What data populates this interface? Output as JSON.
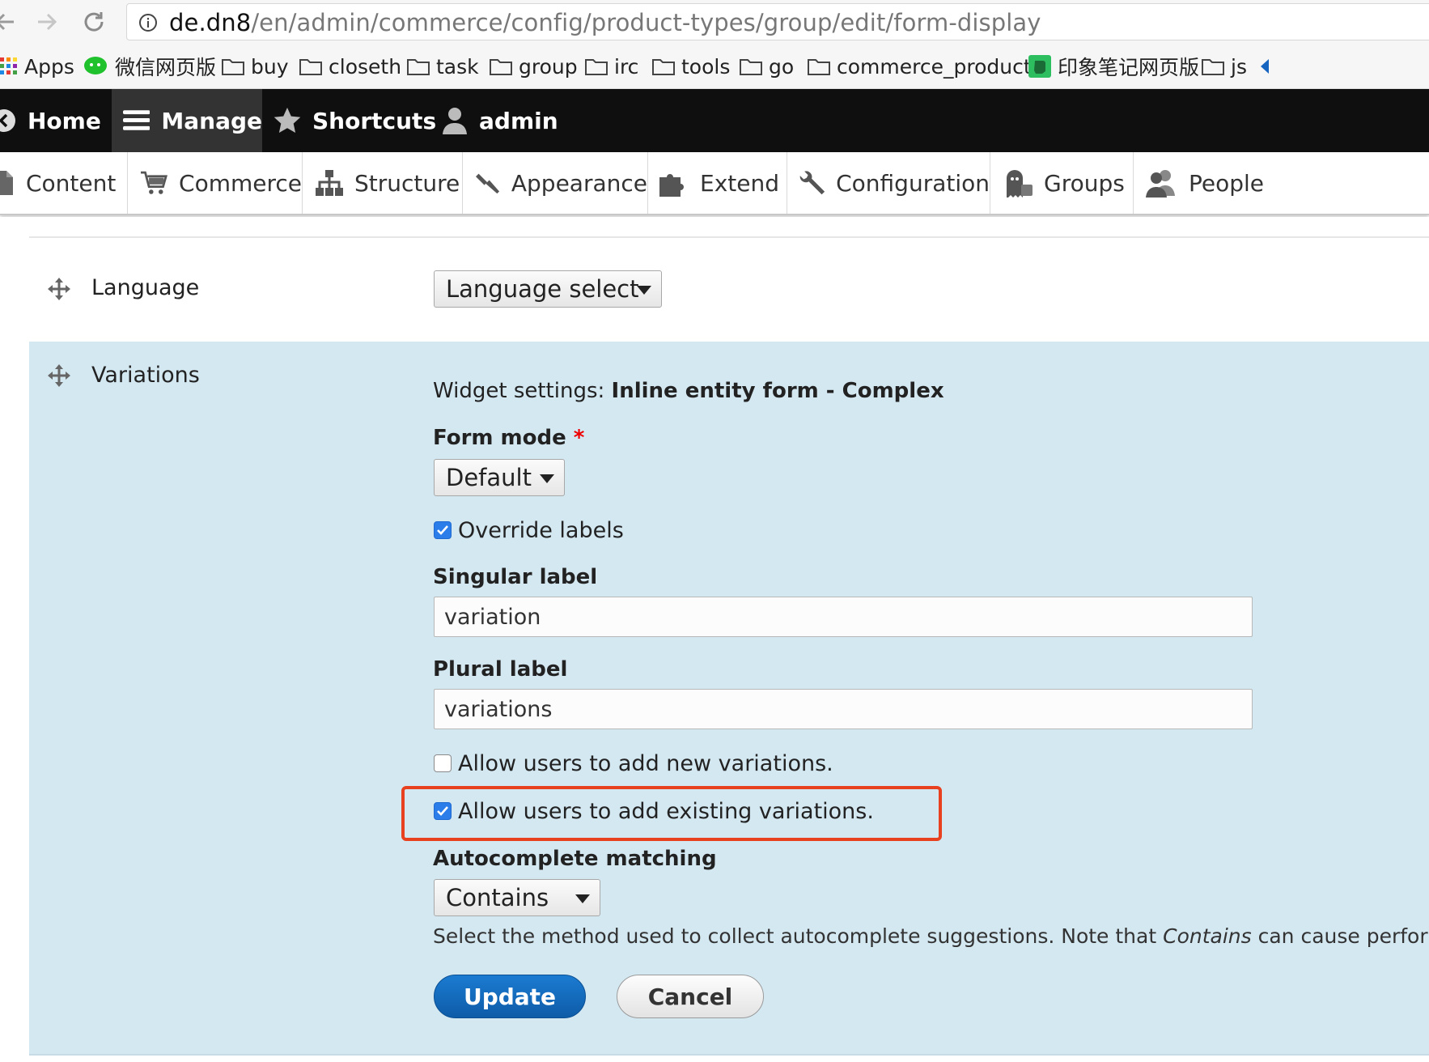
{
  "browser": {
    "url_host": "de.dn8",
    "url_path": "/en/admin/commerce/config/product-types/group/edit/form-display",
    "bookmarks": [
      "Apps",
      "微信网页版",
      "buy",
      "closeth",
      "task",
      "group",
      "irc",
      "tools",
      "go",
      "commerce_product...",
      "印象笔记网页版",
      "js"
    ]
  },
  "toolbar": {
    "home": "Home",
    "manage": "Manage",
    "shortcuts": "Shortcuts",
    "user": "admin"
  },
  "admin_menu": {
    "items": [
      "Content",
      "Commerce",
      "Structure",
      "Appearance",
      "Extend",
      "Configuration",
      "Groups",
      "People"
    ]
  },
  "language_row": {
    "label": "Language",
    "select_value": "Language select"
  },
  "variations_row": {
    "label": "Variations",
    "widget_prefix": "Widget settings: ",
    "widget_name": "Inline entity form - Complex",
    "form_mode_label": "Form mode",
    "required_mark": "*",
    "form_mode_value": "Default",
    "override_labels": {
      "label": "Override labels",
      "checked": true
    },
    "singular_label": {
      "label": "Singular label",
      "value": "variation"
    },
    "plural_label": {
      "label": "Plural label",
      "value": "variations"
    },
    "allow_new": {
      "label": "Allow users to add new variations.",
      "checked": false
    },
    "allow_existing": {
      "label": "Allow users to add existing variations.",
      "checked": true
    },
    "autocomplete_label": "Autocomplete matching",
    "autocomplete_value": "Contains",
    "help_before": "Select the method used to collect autocomplete suggestions. Note that ",
    "help_em": "Contains",
    "help_after": " can cause performanc",
    "update_button": "Update",
    "cancel_button": "Cancel"
  },
  "colors": {
    "toolbar_bg": "#0f0f0f",
    "panel_bg": "#d4e8f2",
    "highlight": "#e8411f",
    "primary_button": "#1070c4"
  }
}
